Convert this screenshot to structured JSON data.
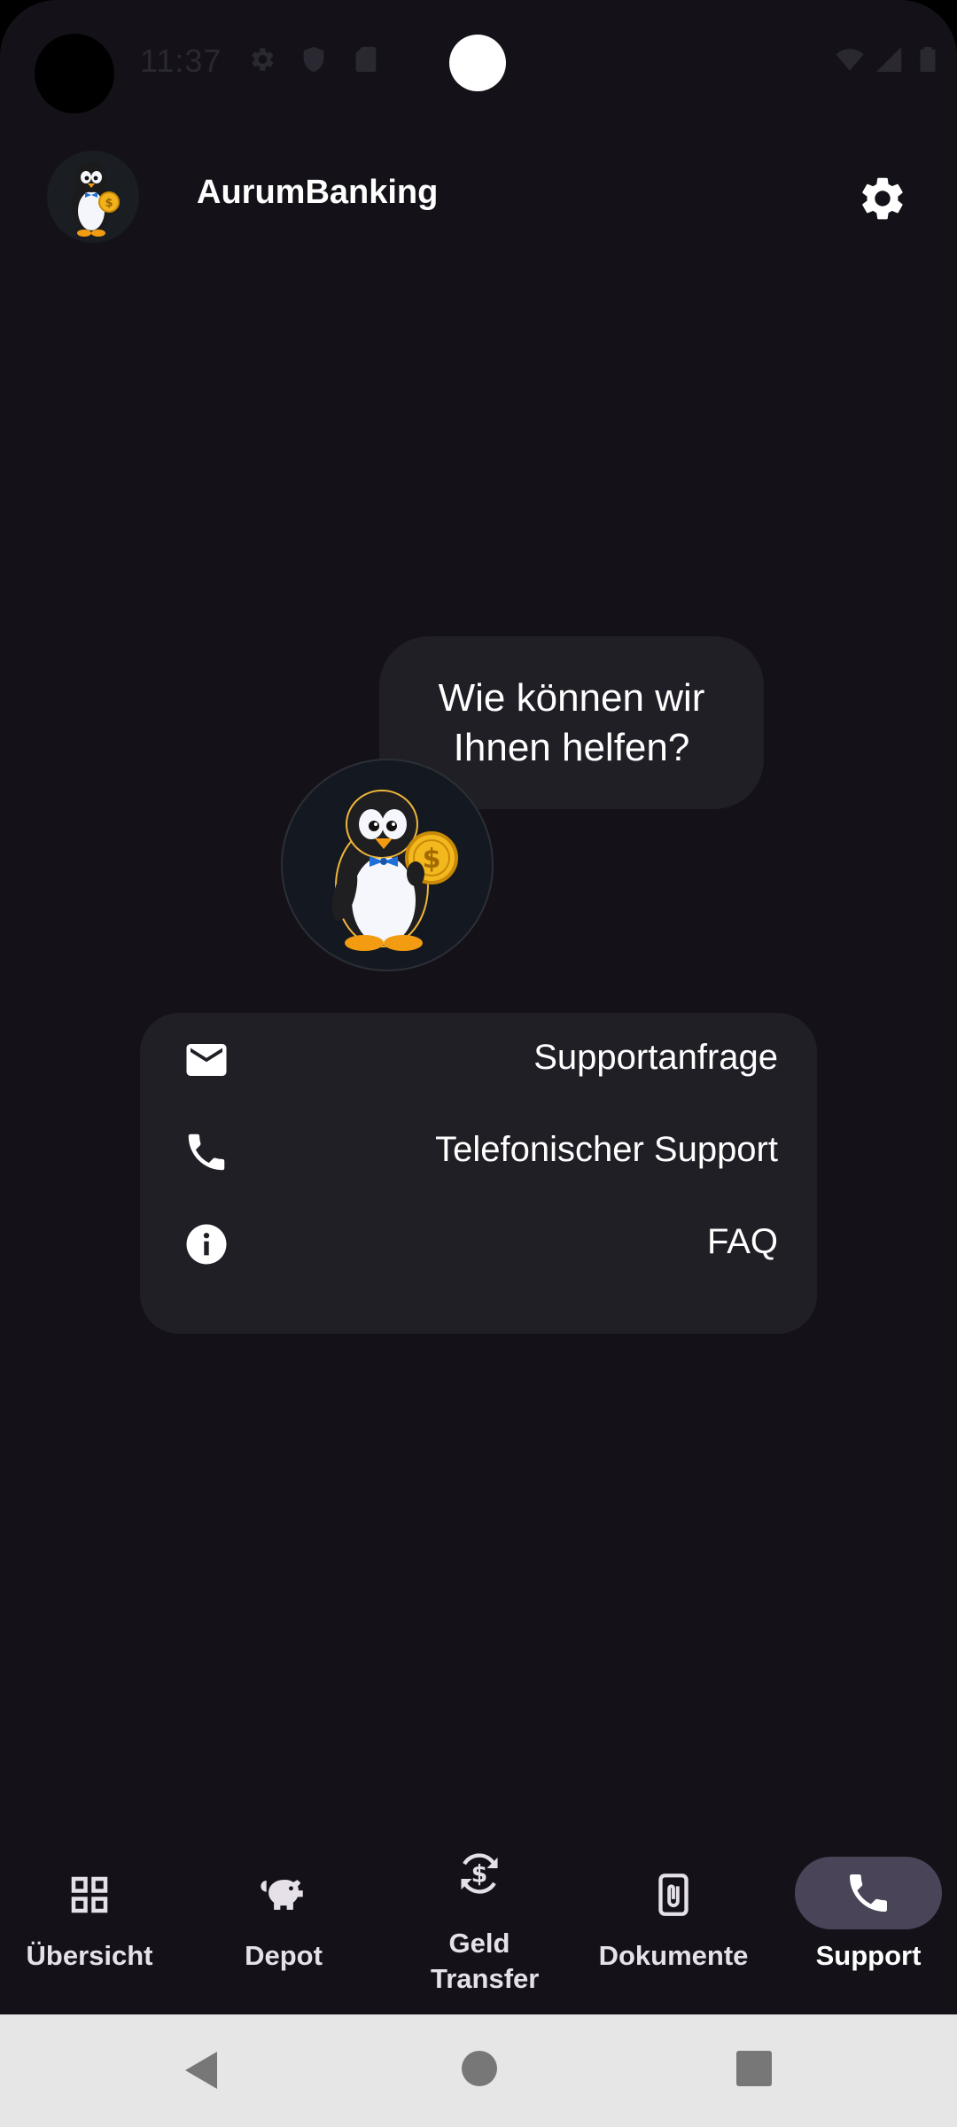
{
  "status_bar": {
    "time": "11:37",
    "icons": [
      "settings-icon",
      "shield-icon",
      "sd-card-icon",
      "wifi-icon",
      "signal-icon",
      "battery-icon"
    ]
  },
  "header": {
    "title": "AurumBanking",
    "logo": "penguin-logo",
    "settings_icon": "gear-icon"
  },
  "support": {
    "bubble_text": "Wie können wir Ihnen helfen?",
    "mascot": "penguin-mascot",
    "options": [
      {
        "icon": "mail-icon",
        "label": "Supportanfrage"
      },
      {
        "icon": "phone-icon",
        "label": "Telefonischer Support"
      },
      {
        "icon": "info-icon",
        "label": "FAQ"
      }
    ]
  },
  "bottom_nav": {
    "items": [
      {
        "icon": "grid-icon",
        "label": "Übersicht"
      },
      {
        "icon": "piggy-bank-icon",
        "label": "Depot"
      },
      {
        "icon": "money-transfer-icon",
        "label": "Geld Transfer"
      },
      {
        "icon": "attachment-icon",
        "label": "Dokumente"
      },
      {
        "icon": "phone-icon",
        "label": "Support"
      }
    ],
    "active": "Support"
  },
  "system_nav": {
    "buttons": [
      "back-icon",
      "home-icon",
      "recents-icon"
    ]
  },
  "colors": {
    "background": "#141218",
    "surface": "#211f26",
    "active_pill": "#4a4458",
    "text": "#ffffff",
    "nav_text": "#e6e0e9",
    "system_bar": "#e6e6e6"
  }
}
